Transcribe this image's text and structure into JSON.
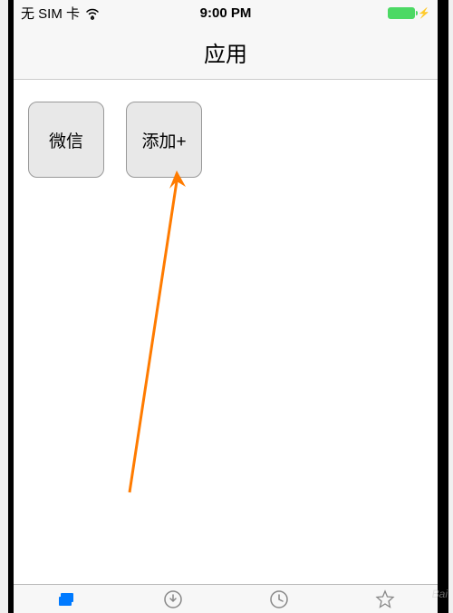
{
  "statusBar": {
    "carrier": "无 SIM 卡",
    "time": "9:00 PM"
  },
  "nav": {
    "title": "应用"
  },
  "tiles": [
    {
      "label": "微信"
    },
    {
      "label": "添加+"
    }
  ],
  "tabs": {
    "active": 0,
    "items": [
      "apps",
      "downloads",
      "recent",
      "favorites"
    ]
  },
  "watermark": "Bai"
}
